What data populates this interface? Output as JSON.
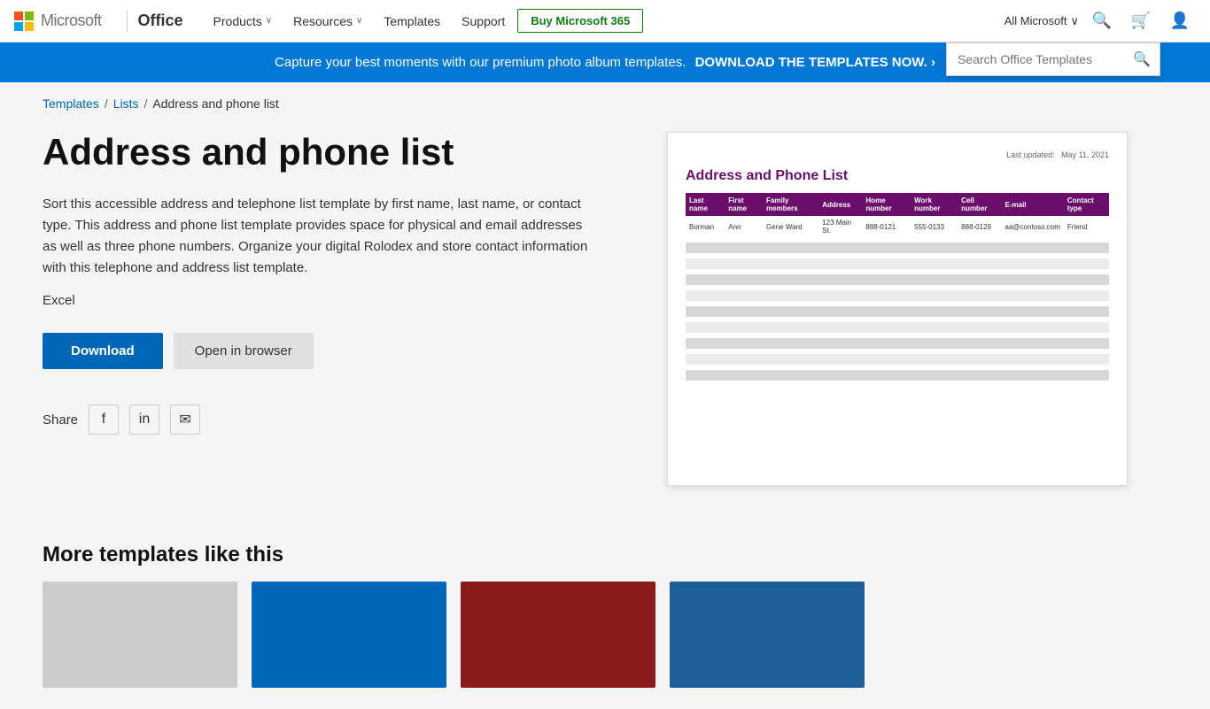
{
  "nav": {
    "logo_text": "Microsoft",
    "office_label": "Office",
    "links": [
      {
        "label": "Products",
        "has_chevron": true
      },
      {
        "label": "Resources",
        "has_chevron": true
      },
      {
        "label": "Templates",
        "has_chevron": false
      },
      {
        "label": "Support",
        "has_chevron": false
      }
    ],
    "buy_button": "Buy Microsoft 365",
    "all_microsoft": "All Microsoft",
    "search_placeholder": "Search Office Templates"
  },
  "banner": {
    "text": "Capture your best moments with our premium photo album templates.",
    "cta": "DOWNLOAD THE TEMPLATES NOW. ›"
  },
  "breadcrumb": {
    "items": [
      "Templates",
      "Lists"
    ],
    "current": "Address and phone list"
  },
  "detail": {
    "title": "Address and phone list",
    "description": "Sort this accessible address and telephone list template by first name, last name, or contact type. This address and phone list template provides space for physical and email addresses as well as three phone numbers. Organize your digital Rolodex and store contact information with this telephone and address list template.",
    "type": "Excel",
    "download_label": "Download",
    "open_label": "Open in browser",
    "share_label": "Share"
  },
  "preview": {
    "meta_label": "Last updated:",
    "meta_date": "May 11, 2021",
    "title": "Address and Phone List",
    "columns": [
      "Last name",
      "First name",
      "Family members",
      "Address",
      "Home number",
      "Work number",
      "Cell number",
      "E-mail",
      "Contact type"
    ],
    "sample_row": [
      "Borman",
      "Ann",
      "Gene Ward",
      "123 Main St.",
      "888-0121",
      "555-0133",
      "888-0129",
      "aa@contoso.com",
      "Friend"
    ]
  },
  "more_section": {
    "title": "More templates like this"
  },
  "icons": {
    "search": "🔍",
    "cart": "🛒",
    "account": "👤",
    "facebook": "f",
    "linkedin": "in",
    "email": "✉"
  }
}
